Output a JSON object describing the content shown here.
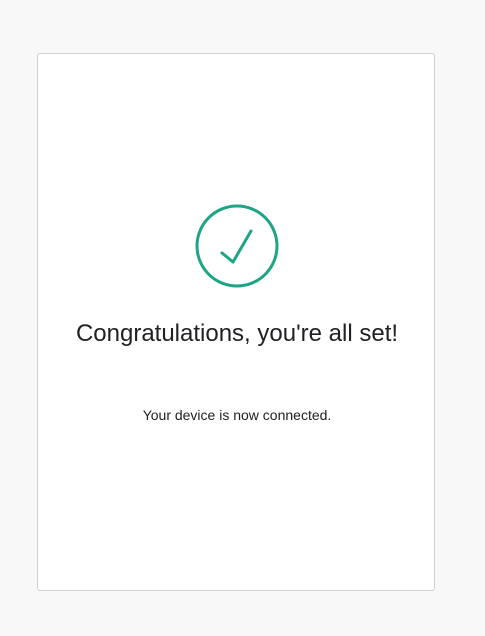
{
  "dialog": {
    "title": "Congratulations, you're all set!",
    "message": "Your device is now connected.",
    "icon": "check-circle-icon",
    "accent_color": "#1ea587"
  }
}
